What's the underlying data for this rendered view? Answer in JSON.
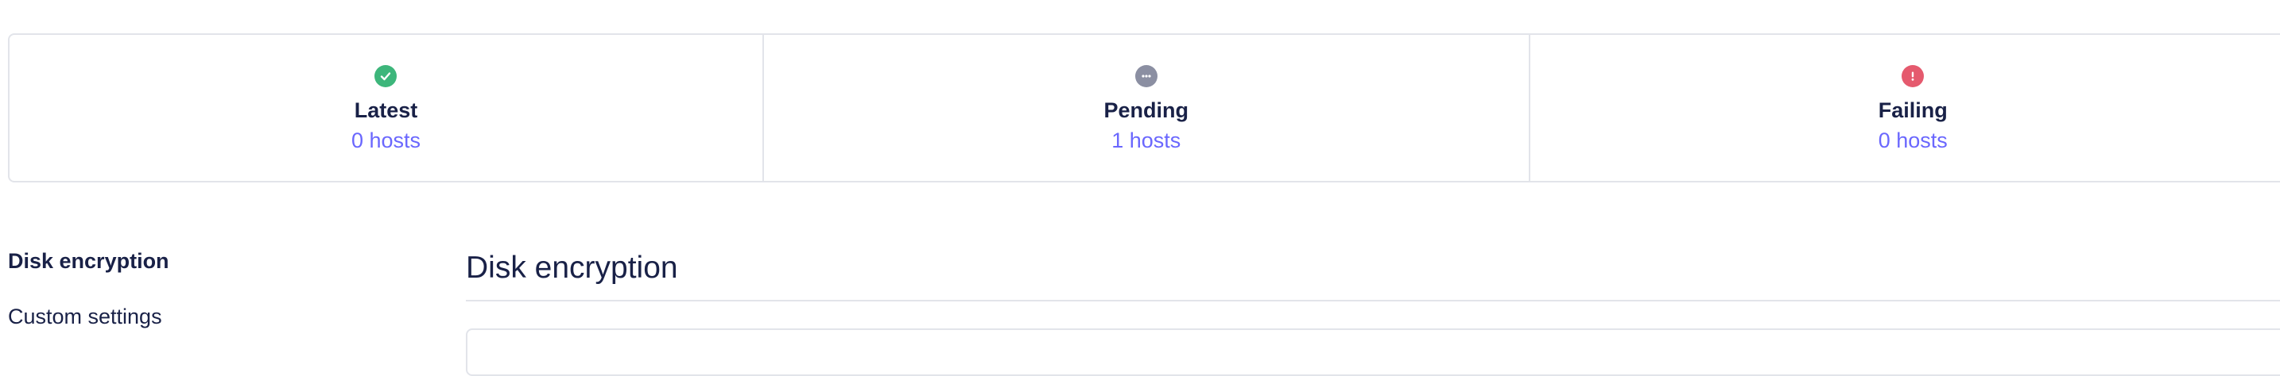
{
  "status_summary": [
    {
      "title": "Latest",
      "count": "0 hosts",
      "icon": "success-check-icon",
      "color": "#3db67b"
    },
    {
      "title": "Pending",
      "count": "1 hosts",
      "icon": "pending-ellipsis-icon",
      "color": "#8b8fa2"
    },
    {
      "title": "Failing",
      "count": "0 hosts",
      "icon": "error-exclamation-icon",
      "color": "#e55a6e"
    }
  ],
  "sidenav": {
    "items": [
      {
        "label": "Disk encryption",
        "active": true
      },
      {
        "label": "Custom settings",
        "active": false
      }
    ]
  },
  "main": {
    "section_title": "Disk encryption"
  }
}
